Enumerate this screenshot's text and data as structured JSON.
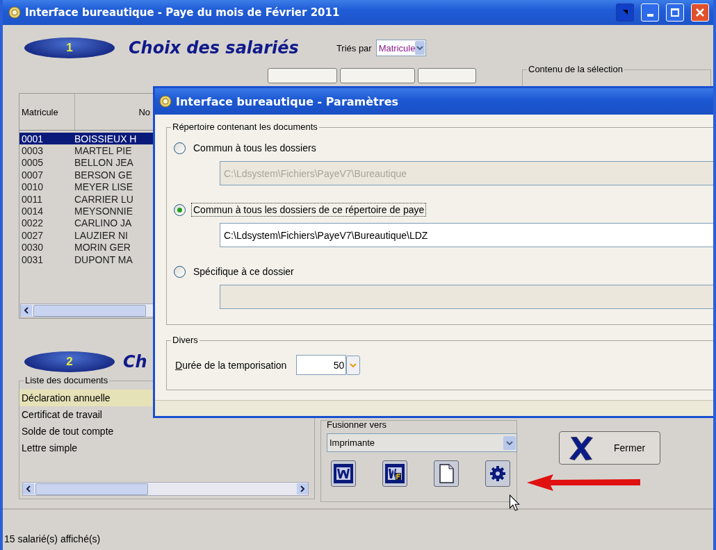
{
  "window": {
    "title": "Interface bureautique - Paye du mois de Février 2011"
  },
  "section_1": {
    "number": "1",
    "title": "Choix des salariés",
    "sort_label": "Triés par",
    "sort_value": "Matricule"
  },
  "selection_group": {
    "title": "Contenu de la sélection"
  },
  "table": {
    "columns": [
      "Matricule",
      "No"
    ],
    "rows": [
      {
        "cells": [
          "0001",
          "BOISSIEUX H"
        ],
        "selected": true
      },
      {
        "cells": [
          "0003",
          "MARTEL PIE"
        ],
        "selected": false
      },
      {
        "cells": [
          "0005",
          "BELLON JEA"
        ],
        "selected": false
      },
      {
        "cells": [
          "0007",
          "BERSON GE"
        ],
        "selected": false
      },
      {
        "cells": [
          "0010",
          "MEYER LISE"
        ],
        "selected": false
      },
      {
        "cells": [
          "0011",
          "CARRIER LU"
        ],
        "selected": false
      },
      {
        "cells": [
          "0014",
          "MEYSONNIE"
        ],
        "selected": false
      },
      {
        "cells": [
          "0022",
          "CARLINO JA"
        ],
        "selected": false
      },
      {
        "cells": [
          "0027",
          "LAUZIER NI"
        ],
        "selected": false
      },
      {
        "cells": [
          "0030",
          "MORIN GER"
        ],
        "selected": false
      },
      {
        "cells": [
          "0031",
          "DUPONT MA"
        ],
        "selected": false
      }
    ]
  },
  "section_2": {
    "number": "2",
    "title": "Ch"
  },
  "documents": {
    "title": "Liste des documents",
    "items": [
      {
        "label": "Déclaration annuelle",
        "selected": true
      },
      {
        "label": "Certificat de travail",
        "selected": false
      },
      {
        "label": "Solde de tout compte",
        "selected": false
      },
      {
        "label": "Lettre simple",
        "selected": false
      }
    ]
  },
  "merge": {
    "label": "Fusionner vers",
    "value": "Imprimante",
    "tools": [
      {
        "kind": "word"
      },
      {
        "kind": "wordfusion"
      },
      {
        "kind": "document"
      },
      {
        "kind": "settings"
      }
    ]
  },
  "close_button": {
    "label": "Fermer"
  },
  "status_bar": "15 salarié(s) affiché(s)",
  "dialog": {
    "title": "Interface bureautique - Paramètres",
    "directory_group": {
      "title": "Répertoire contenant les documents",
      "options": [
        {
          "label": "Commun à tous les dossiers",
          "selected": false,
          "path": {
            "value": "C:\\Ldsystem\\Fichiers\\PayeV7\\Bureautique",
            "disabled": true
          }
        },
        {
          "label": "Commun à tous les dossiers de ce répertoire de paye",
          "selected": true,
          "path": {
            "value": "C:\\Ldsystem\\Fichiers\\PayeV7\\Bureautique\\LDZ",
            "disabled": false
          }
        },
        {
          "label": "Spécifique à ce dossier",
          "selected": false,
          "path": {
            "disabled": true
          }
        }
      ]
    },
    "misc_group": {
      "title": "Divers",
      "delay_label": "Durée de la temporisation",
      "delay_value": "50"
    }
  }
}
